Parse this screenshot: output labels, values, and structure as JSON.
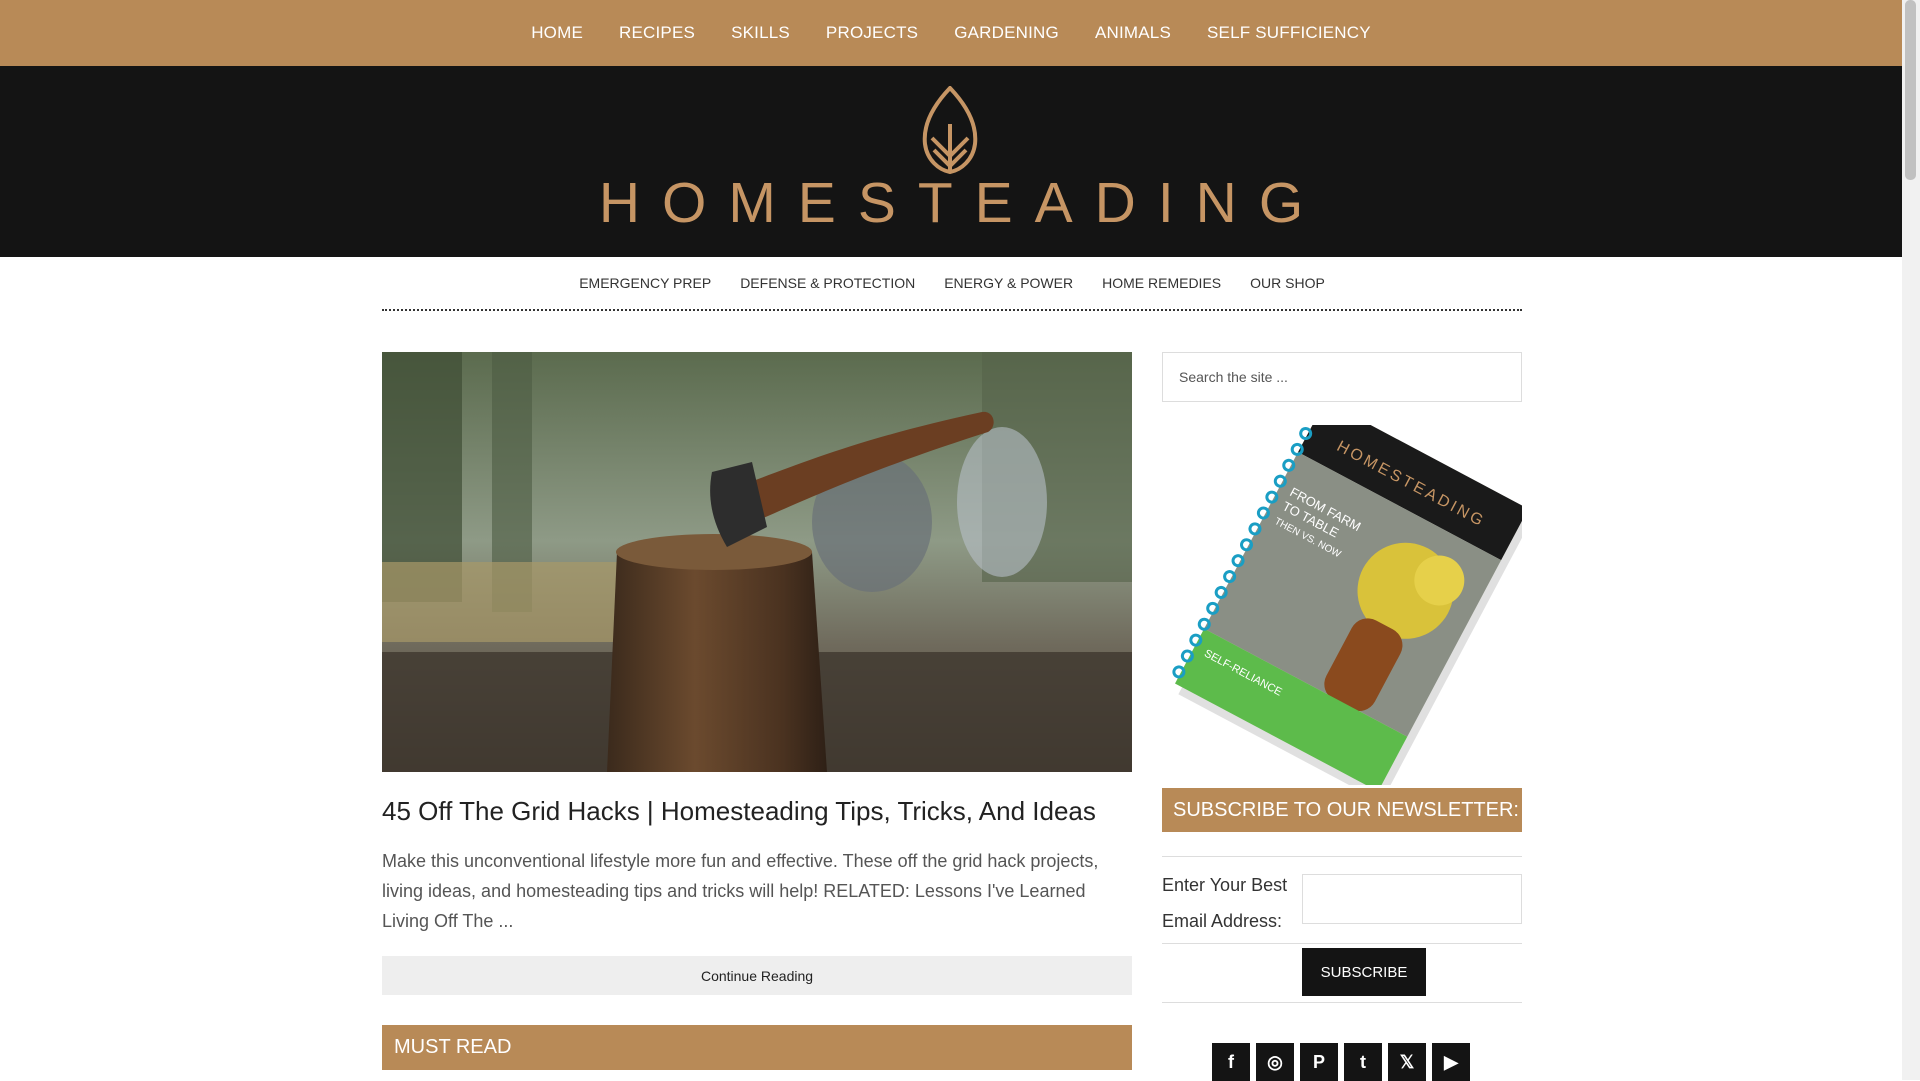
{
  "top_nav": [
    "HOME",
    "RECIPES",
    "SKILLS",
    "PROJECTS",
    "GARDENING",
    "ANIMALS",
    "SELF SUFFICIENCY"
  ],
  "brand": {
    "name": "HOMESTEADING",
    "color": "#c69564"
  },
  "sub_nav": [
    "EMERGENCY PREP",
    "DEFENSE & PROTECTION",
    "ENERGY & POWER",
    "HOME REMEDIES",
    "OUR SHOP"
  ],
  "post": {
    "title": "45 Off The Grid Hacks | Homesteading Tips, Tricks, And Ideas",
    "excerpt": "Make this unconventional lifestyle more fun and effective. These off the grid hack projects, living ideas, and homesteading tips and tricks will help! RELATED: Lessons I've Learned Living Off The ...",
    "continue_label": "Continue Reading"
  },
  "must_read": "MUST READ",
  "sidebar": {
    "search_placeholder": "Search the site ...",
    "book": {
      "brand": "HOMESTEADING",
      "lines": [
        "FROM FARM",
        "TO TABLE",
        "THEN VS. NOW",
        "SELF-RELIANCE"
      ]
    },
    "newsletter_title": "SUBSCRIBE TO OUR NEWSLETTER:",
    "email_label": "Enter Your Best Email Address:",
    "subscribe_label": "SUBSCRIBE"
  },
  "social": [
    {
      "name": "facebook-icon",
      "glyph": "f"
    },
    {
      "name": "instagram-icon",
      "glyph": "◎"
    },
    {
      "name": "pinterest-icon",
      "glyph": "P"
    },
    {
      "name": "tumblr-icon",
      "glyph": "t"
    },
    {
      "name": "x-icon",
      "glyph": "𝕏"
    },
    {
      "name": "youtube-icon",
      "glyph": "▶"
    }
  ],
  "colors": {
    "accent": "#b88a57",
    "dark": "#141414"
  }
}
